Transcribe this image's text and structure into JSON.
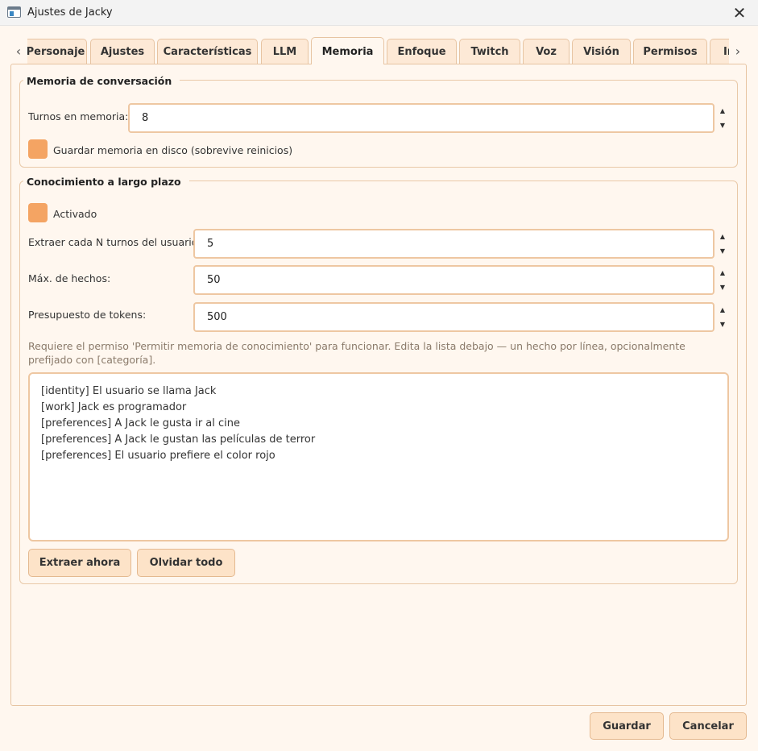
{
  "window": {
    "title": "Ajustes de Jacky",
    "close_glyph": "✕"
  },
  "tabs": {
    "scroll_left_glyph": "‹",
    "scroll_right_glyph": "›",
    "items": [
      {
        "label": "Personaje"
      },
      {
        "label": "Ajustes"
      },
      {
        "label": "Características"
      },
      {
        "label": "LLM"
      },
      {
        "label": "Memoria",
        "active": true
      },
      {
        "label": "Enfoque"
      },
      {
        "label": "Twitch"
      },
      {
        "label": "Voz"
      },
      {
        "label": "Visión"
      },
      {
        "label": "Permisos"
      },
      {
        "label": "In"
      }
    ]
  },
  "conversation": {
    "title": "Memoria de conversación",
    "turns_label": "Turnos en memoria:",
    "turns_value": "8",
    "save_disk_label": "Guardar memoria en disco (sobrevive reinicios)",
    "save_disk_checked": true
  },
  "knowledge": {
    "title": "Conocimiento a largo plazo",
    "enabled_label": "Activado",
    "enabled_checked": true,
    "extract_every_label": "Extraer cada N turnos del usuario:",
    "extract_every_value": "5",
    "max_facts_label": "Máx. de hechos:",
    "max_facts_value": "50",
    "token_budget_label": "Presupuesto de tokens:",
    "token_budget_value": "500",
    "hint": "Requiere el permiso 'Permitir memoria de conocimiento' para funcionar. Edita la lista debajo — un hecho por línea, opcionalmente prefijado con [categoría].",
    "facts": [
      "[identity] El usuario se llama Jack",
      "[work] Jack es programador",
      "[preferences] A Jack le gusta ir al cine",
      "[preferences] A Jack le gustan las películas de terror",
      "[preferences] El usuario prefiere el color rojo"
    ],
    "extract_now_label": "Extraer ahora",
    "forget_all_label": "Olvidar todo"
  },
  "footer": {
    "save_label": "Guardar",
    "cancel_label": "Cancelar"
  },
  "spin": {
    "up_glyph": "▲",
    "down_glyph": "▼"
  },
  "colors": {
    "background": "#fff7ef",
    "accent": "#f4a463",
    "border": "#e7c4a2",
    "button": "#fde3c8"
  }
}
